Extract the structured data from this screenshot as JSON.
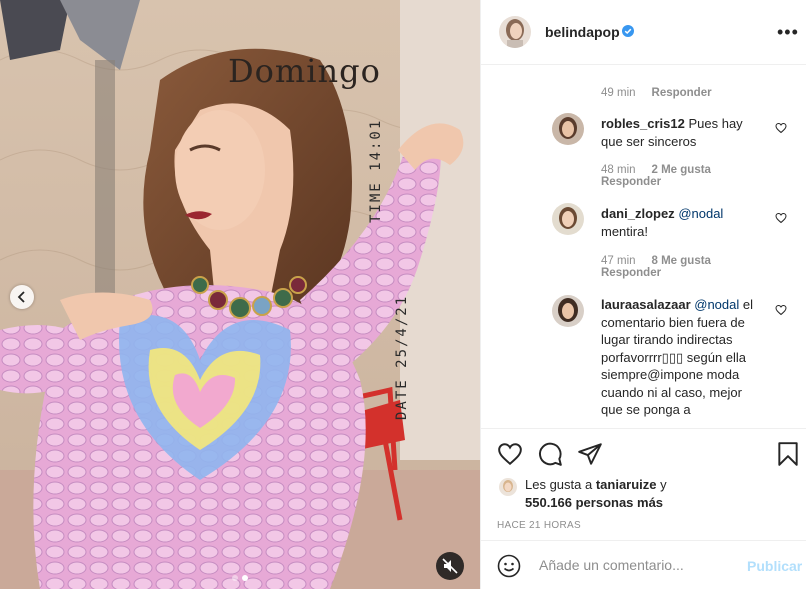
{
  "media": {
    "overlay_title": "Domingo",
    "overlay_time": "TIME 14:01",
    "overlay_date": "DATE 25/4/21"
  },
  "post_header": {
    "username": "belindapop",
    "verified": true
  },
  "comments": [
    {
      "type": "meta_only",
      "time": "49 min",
      "reply_label": "Responder"
    },
    {
      "username": "robles_cris12",
      "text": "Pues hay que ser sinceros",
      "time": "48 min",
      "likes": "2 Me gusta",
      "reply_label": "Responder"
    },
    {
      "username": "dani_zlopez",
      "mention": "@nodal",
      "text": "mentira!",
      "time": "47 min",
      "likes": "8 Me gusta",
      "reply_label": "Responder"
    },
    {
      "username": "lauraasalazaar",
      "mention": "@nodal",
      "text": "el comentario bien fuera de lugar tirando indirectas porfavorrrr▯▯▯ según ella siempre@impone moda cuando ni al caso, mejor que se ponga a"
    }
  ],
  "likes": {
    "prefix": "Les gusta a",
    "user": "taniaruize",
    "connector": "y",
    "others": "550.166 personas más"
  },
  "timestamp": "HACE 21 HORAS",
  "composer": {
    "placeholder": "Añade un comentario...",
    "publish_label": "Publicar"
  },
  "colors": {
    "verified_blue": "#3897f0",
    "mention_blue": "#00376b",
    "publish_disabled": "#b2dffc",
    "meta_gray": "#8e8e8e"
  }
}
